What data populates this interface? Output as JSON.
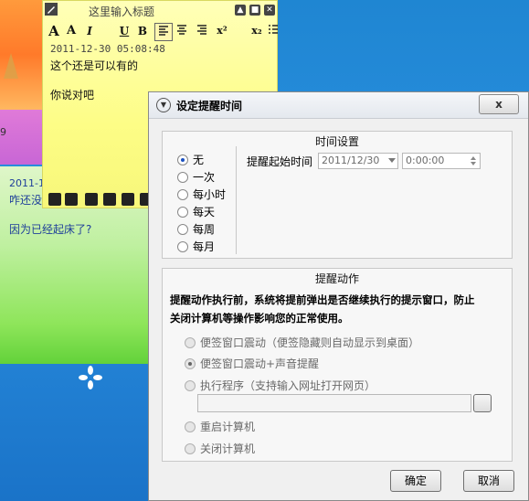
{
  "background": {
    "number_fragment": "9"
  },
  "green_note": {
    "date": "2011-1",
    "line1": "咋还没",
    "line2": "因为已经起床了?"
  },
  "yellow_note": {
    "title": "这里输入标题",
    "window_buttons": [
      "▲",
      "■",
      "✕"
    ],
    "toolbar": {
      "font_larger": "A",
      "font_smaller": "A",
      "italic": "I",
      "underline": "U",
      "bold": "B",
      "subscript": "x₂",
      "superscript": "x²"
    },
    "date": "2011-12-30 05:08:48",
    "line1": "这个还是可以有的",
    "line2": "你说对吧"
  },
  "dialog": {
    "title": "设定提醒时间",
    "close_label": "x",
    "time_settings": {
      "group_title": "时间设置",
      "repeat_options": [
        {
          "label": "无",
          "selected": true
        },
        {
          "label": "一次",
          "selected": false
        },
        {
          "label": "每小时",
          "selected": false
        },
        {
          "label": "每天",
          "selected": false
        },
        {
          "label": "每周",
          "selected": false
        },
        {
          "label": "每月",
          "selected": false
        }
      ],
      "start_time_label": "提醒起始时间",
      "date_value": "2011/12/30",
      "time_value": "0:00:00"
    },
    "action": {
      "group_title": "提醒动作",
      "description_line1": "提醒动作执行前，系统将提前弹出是否继续执行的提示窗口，防止",
      "description_line2": "关闭计算机等操作影响您的正常使用。",
      "options": [
        {
          "label": "便签窗口震动（便签隐藏则自动显示到桌面）",
          "selected": false
        },
        {
          "label": "便签窗口震动+声音提醒",
          "selected": true
        },
        {
          "label": "执行程序（支持输入网址打开网页）",
          "selected": false
        },
        {
          "label": "重启计算机",
          "selected": false
        },
        {
          "label": "关闭计算机",
          "selected": false
        }
      ],
      "program_path": "",
      "browse_label": ""
    },
    "ok_label": "确定",
    "cancel_label": "取消"
  },
  "colors": {
    "accent": "#1a50c0",
    "note_yellow": "#fdfd86",
    "note_green": "#8ee55a",
    "desktop_blue": "#2a8fe0"
  }
}
